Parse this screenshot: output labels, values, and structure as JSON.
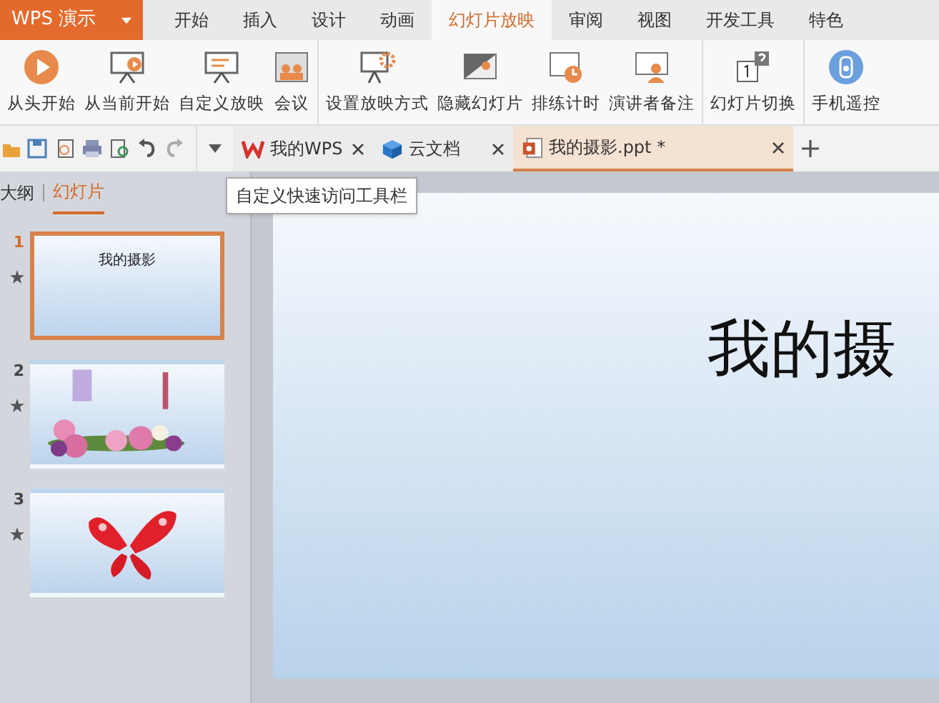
{
  "app_menu": {
    "label": "WPS 演示"
  },
  "ribbon_tabs": [
    {
      "label": "开始",
      "selected": false
    },
    {
      "label": "插入",
      "selected": false
    },
    {
      "label": "设计",
      "selected": false
    },
    {
      "label": "动画",
      "selected": false
    },
    {
      "label": "幻灯片放映",
      "selected": true
    },
    {
      "label": "审阅",
      "selected": false
    },
    {
      "label": "视图",
      "selected": false
    },
    {
      "label": "开发工具",
      "selected": false
    },
    {
      "label": "特色",
      "selected": false
    }
  ],
  "ribbon_groups": [
    [
      {
        "label": "从头开始",
        "kind": "play"
      },
      {
        "label": "从当前开始",
        "kind": "screen-play"
      },
      {
        "label": "自定义放映",
        "kind": "screen"
      },
      {
        "label": "会议",
        "kind": "meeting"
      }
    ],
    [
      {
        "label": "设置放映方式",
        "kind": "settings"
      },
      {
        "label": "隐藏幻灯片",
        "kind": "hide"
      },
      {
        "label": "排练计时",
        "kind": "timer"
      },
      {
        "label": "演讲者备注",
        "kind": "presenter"
      }
    ],
    [
      {
        "label": "幻灯片切换",
        "kind": "switch"
      }
    ],
    [
      {
        "label": "手机遥控",
        "kind": "remote"
      }
    ]
  ],
  "doc_tabs": [
    {
      "label": "我的WPS",
      "kind": "wps",
      "selected": false
    },
    {
      "label": "云文档",
      "kind": "cloud",
      "selected": false
    },
    {
      "label": "我的摄影.ppt *",
      "kind": "ppt",
      "selected": true
    }
  ],
  "tooltip": "自定义快速访问工具栏",
  "panel_tabs": [
    {
      "label": "大纲",
      "selected": false
    },
    {
      "label": "幻灯片",
      "selected": true
    }
  ],
  "slides": [
    {
      "number": "1",
      "selected": true,
      "kind": "title",
      "title": "我的摄影"
    },
    {
      "number": "2",
      "selected": false,
      "kind": "flowers"
    },
    {
      "number": "3",
      "selected": false,
      "kind": "butterfly"
    }
  ],
  "slide": {
    "title": "我的摄"
  }
}
